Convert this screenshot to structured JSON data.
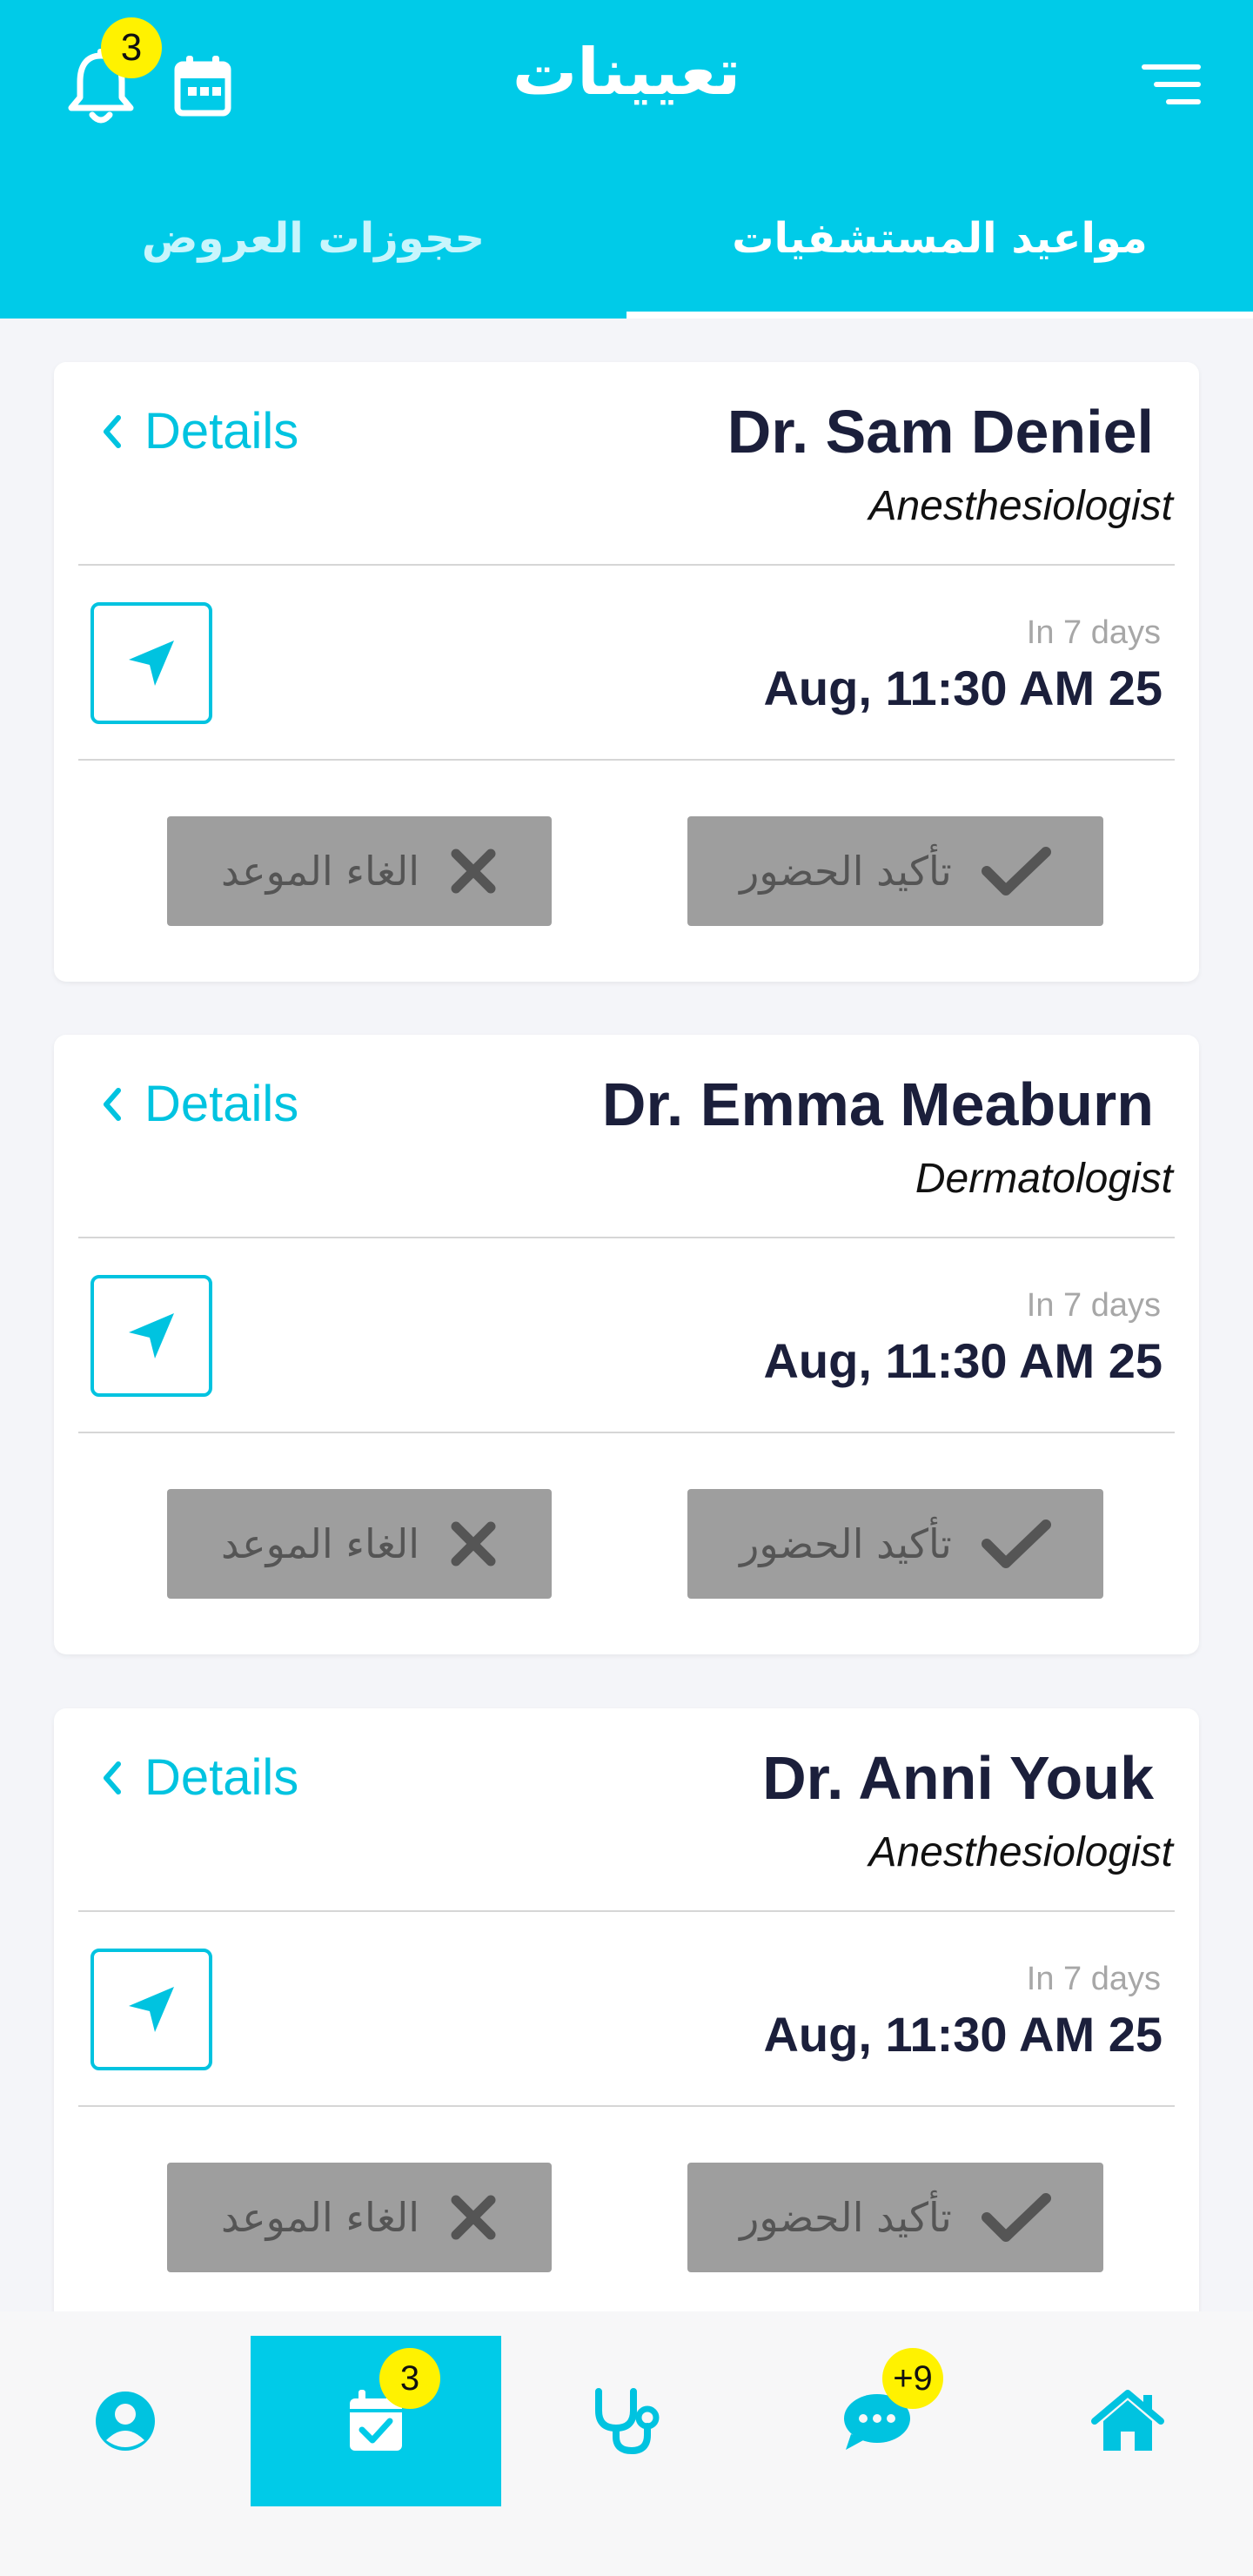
{
  "header": {
    "title": "تعيينات",
    "notification_count": "3",
    "tabs": [
      {
        "label": "مواعيد المستشفيات",
        "active": true
      },
      {
        "label": "حجوزات العروض",
        "active": false
      }
    ]
  },
  "appointments": [
    {
      "doctor": "Dr. Sam Deniel",
      "specialty": "Anesthesiologist",
      "details_label": "Details",
      "relative": "In 7 days",
      "datetime": "Aug, 11:30 AM 25",
      "cancel_label": "الغاء الموعد",
      "confirm_label": "تأكيد الحضور"
    },
    {
      "doctor": "Dr. Emma Meaburn",
      "specialty": "Dermatologist",
      "details_label": "Details",
      "relative": "In 7 days",
      "datetime": "Aug, 11:30 AM 25",
      "cancel_label": "الغاء الموعد",
      "confirm_label": "تأكيد الحضور"
    },
    {
      "doctor": "Dr. Anni Youk",
      "specialty": "Anesthesiologist",
      "details_label": "Details",
      "relative": "In 7 days",
      "datetime": "Aug, 11:30 AM 25",
      "cancel_label": "الغاء الموعد",
      "confirm_label": "تأكيد الحضور"
    }
  ],
  "bottom_nav": {
    "items": [
      "profile-icon",
      "appointments-icon",
      "doctor-icon",
      "chat-icon",
      "home-icon"
    ],
    "appointments_badge": "3",
    "chat_badge": "+9"
  },
  "colors": {
    "accent": "#00cbe8",
    "text_dark": "#1b1f3b",
    "button_disabled": "#9e9e9e",
    "badge": "#fff200"
  }
}
